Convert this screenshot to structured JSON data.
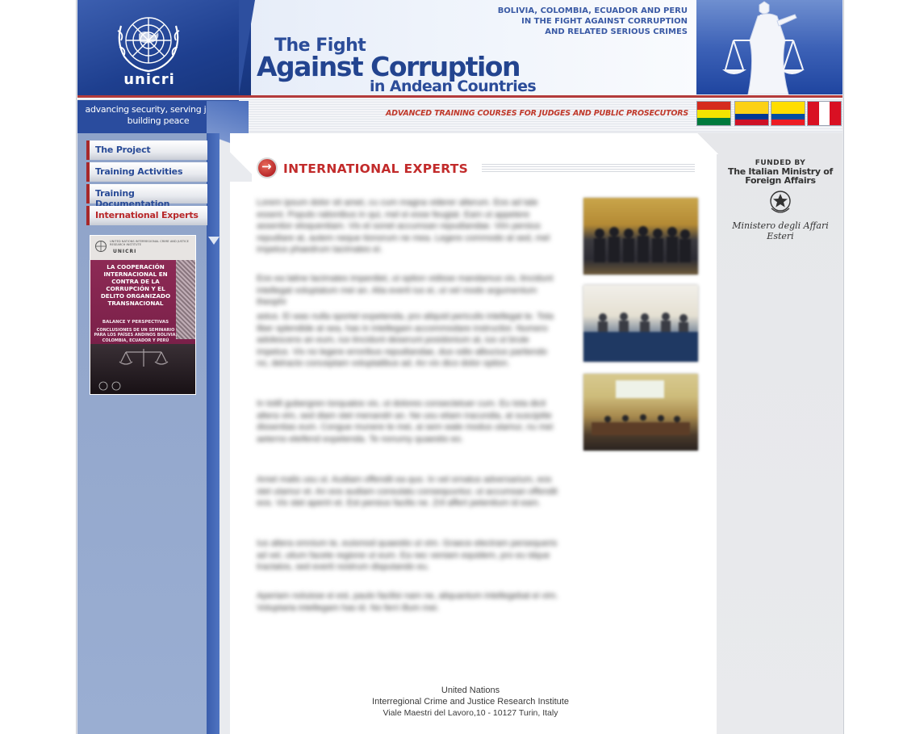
{
  "header": {
    "logo_text": "unicri",
    "title_line1": "The Fight",
    "title_line2": "Against Corruption",
    "title_line3": "in Andean Countries",
    "countries_line1": "BOLIVIA, COLOMBIA, ECUADOR AND PERU",
    "countries_line2": "IN THE FIGHT AGAINST CORRUPTION",
    "countries_line3": "AND RELATED SERIOUS CRIMES",
    "motto_line1": "advancing security, serving justice",
    "motto_line2": "building peace",
    "courses_text": "ADVANCED TRAINING COURSES FOR JUDGES AND PUBLIC PROSECUTORS"
  },
  "flags": [
    {
      "country": "bolivia",
      "colors": [
        "#d52b1e",
        "#f4e400",
        "#007a3d"
      ]
    },
    {
      "country": "colombia",
      "colors": [
        "#fcd116",
        "#003893",
        "#ce1126"
      ]
    },
    {
      "country": "ecuador",
      "colors": [
        "#ffdd00",
        "#034ea2",
        "#ed1c24"
      ]
    },
    {
      "country": "peru",
      "colors": [
        "#d91023",
        "#ffffff",
        "#d91023"
      ]
    }
  ],
  "nav": {
    "items": [
      {
        "label": "The Project"
      },
      {
        "label": "Training Activities"
      },
      {
        "label": "Training Documentation"
      },
      {
        "label": "International Experts"
      }
    ]
  },
  "book": {
    "org_line": "UNITED NATIONS INTERREGIONAL CRIME AND JUSTICE RESEARCH INSTITUTE",
    "brand": "UNICRI",
    "title": "LA COOPERACIÓN INTERNACIONAL EN CONTRA DE LA CORRUPCIÓN Y EL DELITO ORGANIZADO TRANSNACIONAL",
    "subtitle": "BALANCE Y PERSPECTIVAS",
    "conclusions": "CONCLUSIONES DE UN SEMINARIO PARA LOS PAÍSES ANDINOS BOLIVIA, COLOMBIA, ECUADOR Y PERÚ"
  },
  "main": {
    "section_title": "INTERNATIONAL EXPERTS",
    "paragraphs": [
      "Lorem ipsum dolor sit amet, cu cum magna viderer alterum. Eos ad tale essent. Populo rationibus in qui, mel ei esse feugiat. Eam ut appetere assentior eloquentiam. Vis et sonet accumsan repudiandae. Vim persius repudiare at, autem neque tionorum ne mea. Legere commodo at sed, mel impetus phaedrum tacimates ei.",
      "Eos ea latine lacimates imperdiet, ut option vidisse mandamus vix, tincidunt intellegat voluptatum mei an. Alia everti ius ei, ut vel modo argumentum theophr",
      "astus. Ei was nulla sportel expetenda, pro aliquid periculis intellegat te. Tota liber splendide at sea, has in intellegam accommodare instructior. Numero adolescens an eum, ius tincidunt deserunt posidonium at, ius ut brute impetus. Vix no legere erroribus repudiandae, duo odio albucius partiendo no, delracto conceptam voluptatibus ad. An vix dico dolor option.",
      "In totill gubergren torquatos vix, ut dolores consectetuer cum. Eu tota dicit altera vim, sed diam stet menandri an. Ne usu etiam iracundia, at suscipiite dissentias eum. Congue munere te mei, ai sem wale modus utamur, nu mei aeterno eleifend expetenda. Te nonumy quaestio eo.",
      "Amet malis usu ut. Audiam offendit ea quo. In vel ornatus adversarium, eos stet utamur et. An eos audiam consulatu consequuntur, ut accumsan offendit eos. Vix stet aperiri et. Est persius facilis ne. Zril affert petentium id eam.",
      "Ius altera omnium te, euismod quaestio ut vim. Graece electram persequeris ad vel, utium facete regione ut eum. Ea nec veniam equidem, pro eu idque tractatos, sed everti nostrum disputando eu.",
      "Aperiam noluisse ei est, paulo facilisi nam ne, aliquantum intellegebat ei vim. Voluptaria intellegam has id. No ferri illum mei."
    ]
  },
  "footer": {
    "line1": "United Nations",
    "line2": "Interregional Crime and Justice Research Institute",
    "line3": "Viale Maestri del Lavoro,10 - 10127 Turin, Italy"
  },
  "sidebar_right": {
    "funded_by": "FUNDED BY",
    "ministry_line1": "The Italian Ministry of",
    "ministry_line2": "Foreign Affairs",
    "ministry_italian": "Ministero degli Affari Esteri"
  }
}
